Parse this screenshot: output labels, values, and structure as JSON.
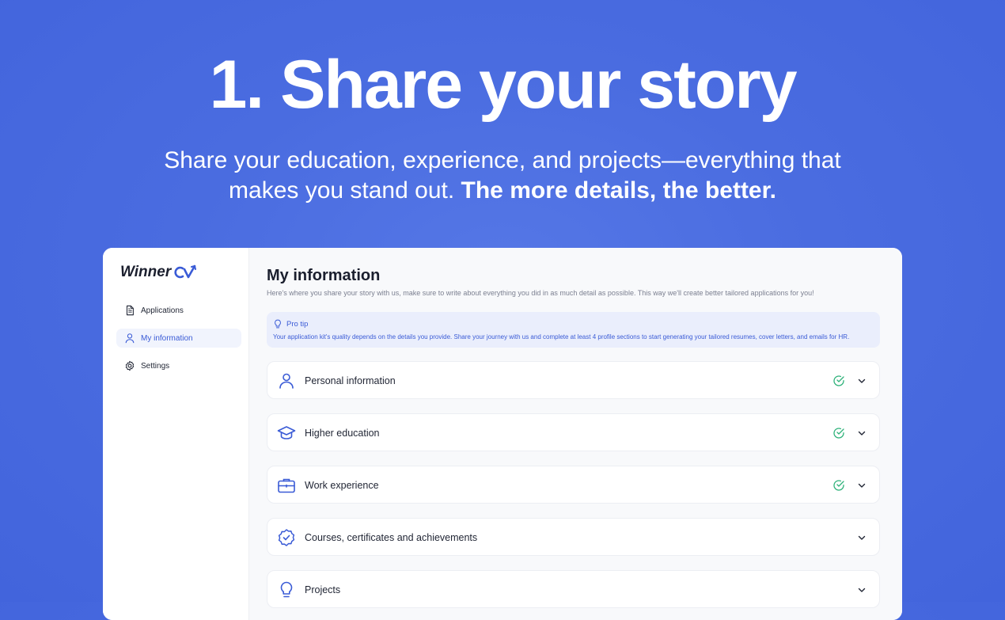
{
  "hero": {
    "title": "1. Share your story",
    "subtitle_line1": "Share your education, experience, and projects—everything that",
    "subtitle_line2_regular": "makes you stand out.",
    "subtitle_line2_bold": "The more details, the better."
  },
  "app": {
    "logo_text": "Winner",
    "logo_mark": "cv-logo-icon"
  },
  "sidebar": {
    "items": [
      {
        "label": "Applications",
        "icon": "document-icon",
        "active": false
      },
      {
        "label": "My information",
        "icon": "user-icon",
        "active": true
      },
      {
        "label": "Settings",
        "icon": "gear-icon",
        "active": false
      }
    ]
  },
  "main": {
    "title": "My information",
    "description": "Here's where you share your story with us, make sure to write about everything you did in as much detail as possible. This way we'll create better tailored applications for you!",
    "tip": {
      "heading": "Pro tip",
      "body": "Your application kit's quality depends on the details you provide. Share your journey with us and complete at least 4 profile sections to start generating your tailored resumes, cover letters, and emails for HR."
    },
    "sections": [
      {
        "label": "Personal information",
        "icon": "user-icon",
        "completed": true
      },
      {
        "label": "Higher education",
        "icon": "graduation-cap-icon",
        "completed": true
      },
      {
        "label": "Work experience",
        "icon": "briefcase-icon",
        "completed": true
      },
      {
        "label": "Courses, certificates and achievements",
        "icon": "badge-check-icon",
        "completed": false
      },
      {
        "label": "Projects",
        "icon": "lightbulb-icon",
        "completed": false
      }
    ]
  },
  "colors": {
    "background": "#4a6ce0",
    "accent": "#3a5bd6",
    "success": "#2fb27a",
    "text": "#1f2433"
  }
}
